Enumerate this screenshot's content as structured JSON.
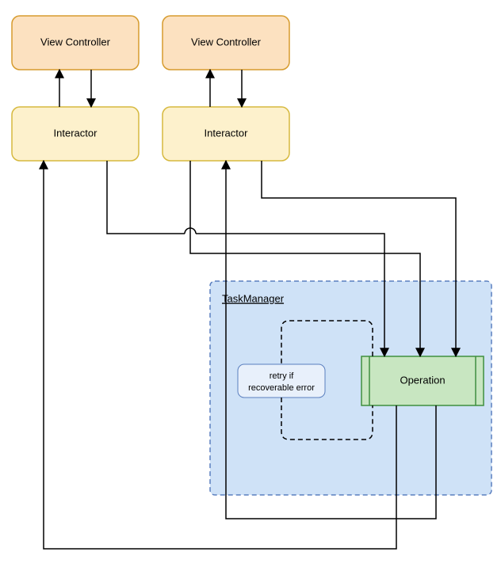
{
  "boxes": {
    "vc1": "View Controller",
    "vc2": "View Controller",
    "int1": "Interactor",
    "int2": "Interactor",
    "operation": "Operation",
    "retry1": "retry if",
    "retry2": "recoverable error"
  },
  "container": {
    "title": "TaskManager"
  },
  "colors": {
    "vc_fill": "#fce1c0",
    "vc_stroke": "#d69b2e",
    "int_fill": "#fdf1cc",
    "int_stroke": "#d6b93f",
    "tm_fill": "#cfe2f7",
    "tm_stroke": "#5a7fbf",
    "retry_fill": "#e8f0fb",
    "retry_stroke": "#5a7fbf",
    "op_fill": "#c8e6c1",
    "op_stroke": "#3f8f3f",
    "arrow": "#000"
  }
}
